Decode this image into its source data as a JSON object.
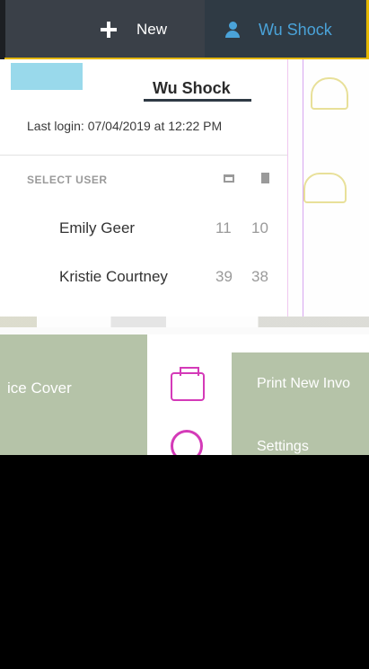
{
  "topbar": {
    "new_label": "New",
    "user_label": "Wu Shock"
  },
  "panel": {
    "title": "Wu Shock",
    "last_login": "Last login: 07/04/2019 at 12:22 PM",
    "select_user_label": "SELECT USER",
    "users": [
      {
        "name": "Emily Geer",
        "count_a": "11",
        "count_b": "10"
      },
      {
        "name": "Kristie Courtney",
        "count_a": "39",
        "count_b": "38"
      }
    ]
  },
  "tiles": {
    "left_label": "ice Cover",
    "right_label": "Print New Invo",
    "settings_label": "Settings"
  },
  "colors": {
    "accent_blue": "#4aa3d9",
    "highlight_yellow": "#e6b800",
    "icon_magenta": "#d43ab8",
    "tile_green": "#b5c3a8"
  },
  "icons": [
    "plus-icon",
    "user-icon",
    "card-icon",
    "document-icon",
    "printer-icon",
    "gear-icon"
  ]
}
